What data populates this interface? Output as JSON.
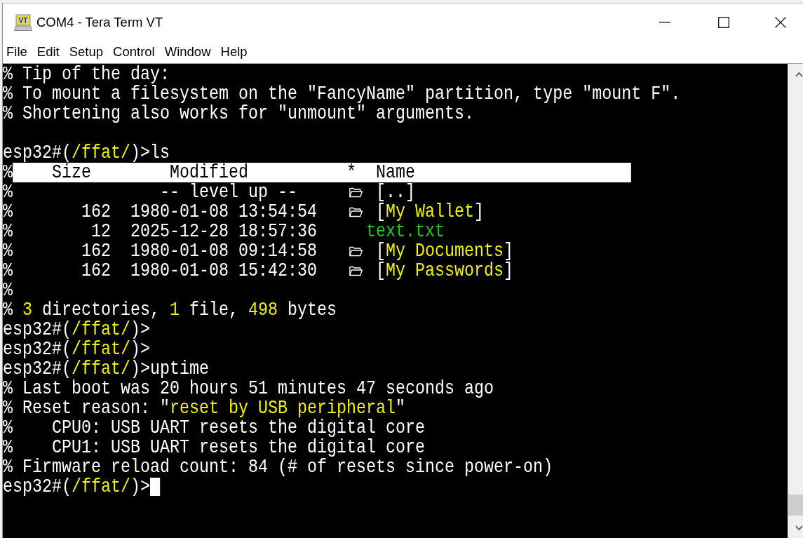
{
  "window": {
    "title": "COM4 - Tera Term VT",
    "icon_label": "VT"
  },
  "menu": [
    "File",
    "Edit",
    "Setup",
    "Control",
    "Window",
    "Help"
  ],
  "terminal": {
    "lines": [
      {
        "kind": "text",
        "runs": [
          {
            "text": "% Tip of the day:",
            "kind": "plain"
          }
        ]
      },
      {
        "kind": "text",
        "runs": [
          {
            "text": "% To mount a filesystem on the \"FancyName\" partition, type \"mount F\".",
            "kind": "plain"
          }
        ]
      },
      {
        "kind": "text",
        "runs": [
          {
            "text": "% Shortening also works for \"unmount\" arguments.",
            "kind": "plain"
          }
        ]
      },
      {
        "kind": "blank"
      },
      {
        "kind": "prompt",
        "cursor": false,
        "runs": [
          {
            "text": "esp32#(",
            "kind": "plain"
          },
          {
            "text": "/ffat/",
            "kind": "accent"
          },
          {
            "text": ")>ls",
            "kind": "plain"
          }
        ]
      },
      {
        "kind": "header",
        "prefix": "%",
        "columns": [
          "Size",
          "Modified",
          "*",
          "Name"
        ]
      },
      {
        "kind": "parent",
        "prefix": "%",
        "label": "-- level up --",
        "name": [
          {
            "text": "[..]",
            "kind": "plain"
          }
        ]
      },
      {
        "kind": "directory",
        "prefix": "%",
        "size": "162",
        "modified": "1980-01-08 13:54:54",
        "name": [
          {
            "text": "[",
            "kind": "plain"
          },
          {
            "text": "My Wallet",
            "kind": "accent"
          },
          {
            "text": "]",
            "kind": "plain"
          }
        ]
      },
      {
        "kind": "file",
        "prefix": "%",
        "size": "12",
        "modified": "2025-12-28 18:57:36",
        "name": [
          {
            "text": "text.txt",
            "kind": "file"
          }
        ]
      },
      {
        "kind": "directory",
        "prefix": "%",
        "size": "162",
        "modified": "1980-01-08 09:14:58",
        "name": [
          {
            "text": "[",
            "kind": "plain"
          },
          {
            "text": "My Documents",
            "kind": "accent"
          },
          {
            "text": "]",
            "kind": "plain"
          }
        ]
      },
      {
        "kind": "directory",
        "prefix": "%",
        "size": "162",
        "modified": "1980-01-08 15:42:30",
        "name": [
          {
            "text": "[",
            "kind": "plain"
          },
          {
            "text": "My Passwords",
            "kind": "accent"
          },
          {
            "text": "]",
            "kind": "plain"
          }
        ]
      },
      {
        "kind": "text",
        "runs": [
          {
            "text": "%",
            "kind": "plain"
          }
        ]
      },
      {
        "kind": "text",
        "runs": [
          {
            "text": "% ",
            "kind": "plain"
          },
          {
            "text": "3",
            "kind": "accent"
          },
          {
            "text": " directories, ",
            "kind": "plain"
          },
          {
            "text": "1",
            "kind": "accent"
          },
          {
            "text": " file, ",
            "kind": "plain"
          },
          {
            "text": "498",
            "kind": "accent"
          },
          {
            "text": " bytes",
            "kind": "plain"
          }
        ]
      },
      {
        "kind": "prompt",
        "cursor": false,
        "runs": [
          {
            "text": "esp32#(",
            "kind": "plain"
          },
          {
            "text": "/ffat/",
            "kind": "accent"
          },
          {
            "text": ")>",
            "kind": "plain"
          }
        ]
      },
      {
        "kind": "prompt",
        "cursor": false,
        "runs": [
          {
            "text": "esp32#(",
            "kind": "plain"
          },
          {
            "text": "/ffat/",
            "kind": "accent"
          },
          {
            "text": ")>",
            "kind": "plain"
          }
        ]
      },
      {
        "kind": "prompt",
        "cursor": false,
        "runs": [
          {
            "text": "esp32#(",
            "kind": "plain"
          },
          {
            "text": "/ffat/",
            "kind": "accent"
          },
          {
            "text": ")>uptime",
            "kind": "plain"
          }
        ]
      },
      {
        "kind": "text",
        "runs": [
          {
            "text": "% Last boot was 20 hours 51 minutes 47 seconds ago",
            "kind": "plain"
          }
        ]
      },
      {
        "kind": "text",
        "runs": [
          {
            "text": "% Reset reason: \"",
            "kind": "plain"
          },
          {
            "text": "reset by USB peripheral",
            "kind": "accent"
          },
          {
            "text": "\"",
            "kind": "plain"
          }
        ]
      },
      {
        "kind": "text",
        "runs": [
          {
            "text": "%    CPU0: USB UART resets the digital core",
            "kind": "plain"
          }
        ]
      },
      {
        "kind": "text",
        "runs": [
          {
            "text": "%    CPU1: USB UART resets the digital core",
            "kind": "plain"
          }
        ]
      },
      {
        "kind": "text",
        "runs": [
          {
            "text": "% Firmware reload count: 84 (# of resets since power-on)",
            "kind": "plain"
          }
        ]
      },
      {
        "kind": "prompt",
        "cursor": true,
        "runs": [
          {
            "text": "esp32#(",
            "kind": "plain"
          },
          {
            "text": "/ffat/",
            "kind": "accent"
          },
          {
            "text": ")>",
            "kind": "plain"
          }
        ]
      }
    ]
  }
}
